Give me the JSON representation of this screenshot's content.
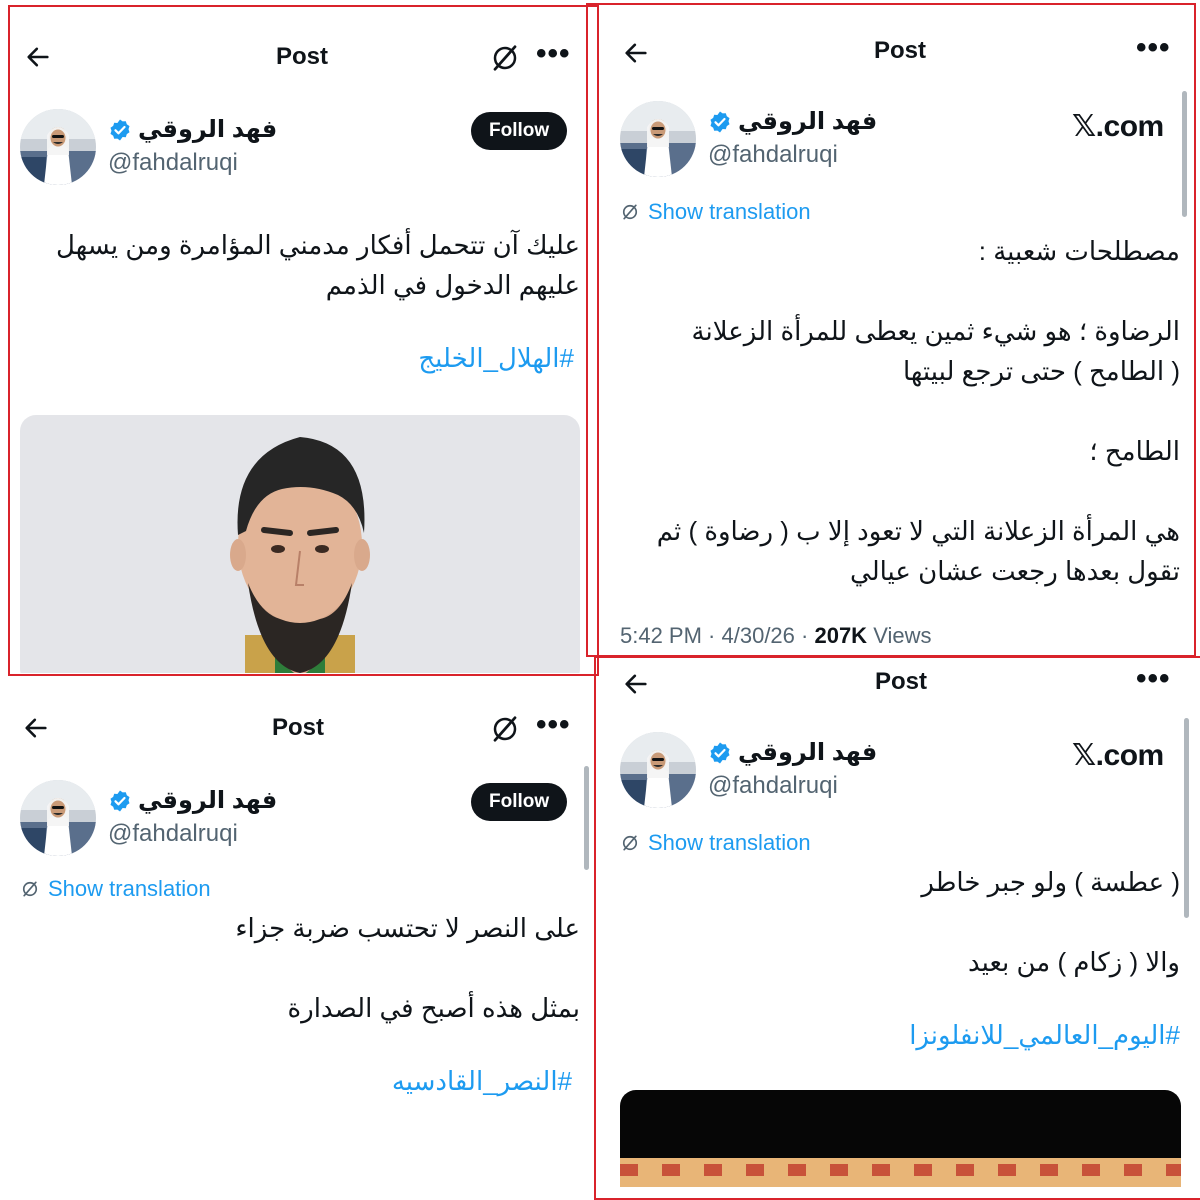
{
  "author": {
    "name": "فهد الروقي",
    "handle": "@fahdalruqi"
  },
  "common": {
    "header_title": "Post",
    "more_label": "•••",
    "follow_label": "Follow",
    "show_translation": "Show translation",
    "xcom_label": "𝕏.com"
  },
  "panel1": {
    "text": "عليك آن تتحمل أفكار مدمني المؤامرة ومن يسهل\nعليهم الدخول في الذمم",
    "hashtag": "#الهلال_الخليج"
  },
  "panel2": {
    "text": "مصطلحات شعبية :\n\nالرضاوة ؛ هو شيء ثمين يعطى للمرأة الزعلانة\n( الطامح ) حتى ترجع لبيتها\n\nالطامح ؛\n\nهي المرأة الزعلانة التي لا تعود إلا ب ( رضاوة ) ثم\nتقول بعدها رجعت عشان عيالي",
    "time": "5:42 PM",
    "date": "4/30/26",
    "views_count": "207K",
    "views_label": "Views"
  },
  "panel3": {
    "text": "على النصر لا تحتسب ضربة جزاء\n\nبمثل هذه أصبح في الصدارة",
    "hashtag": "#النصر_القادسيه"
  },
  "panel4": {
    "text": "( عطسة ) ولو جبر خاطر\n\nوالا ( زكام ) من بعيد",
    "hashtag": "#اليوم_العالمي_للانفلونزا"
  },
  "colors": {
    "accent": "#1d9bf0",
    "frame": "#d9232b",
    "text": "#0f1419",
    "muted": "#536471"
  }
}
